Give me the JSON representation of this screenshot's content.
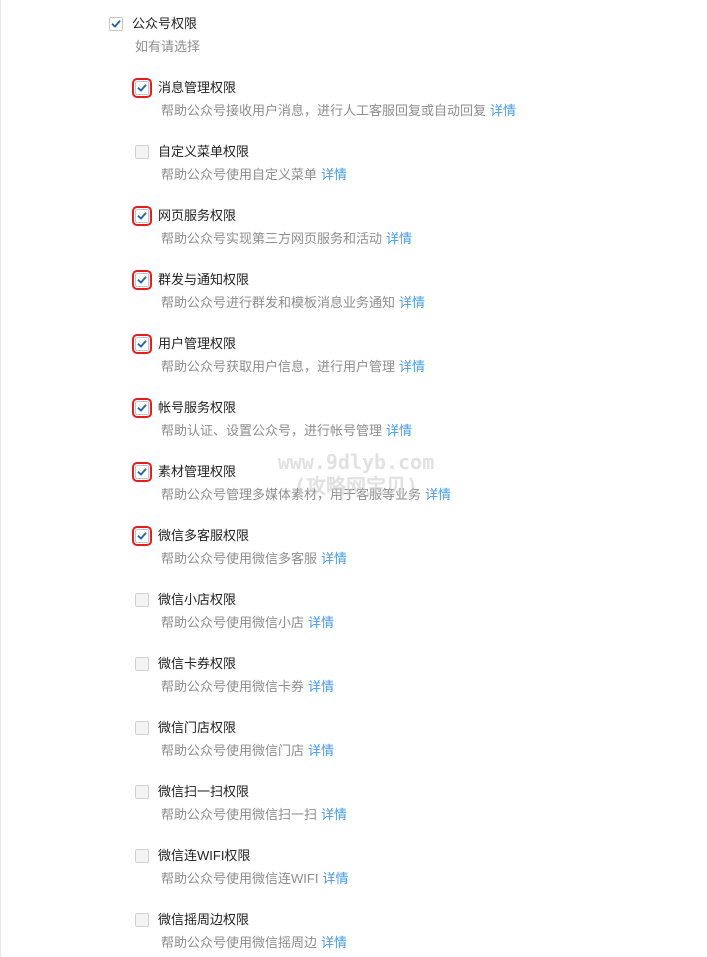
{
  "master": {
    "label": "公众号权限",
    "hint": "如有请选择",
    "checked": true
  },
  "detail_label": "详情",
  "permissions": [
    {
      "label": "消息管理权限",
      "desc": "帮助公众号接收用户消息，进行人工客服回复或自动回复",
      "checked": true,
      "highlighted": true
    },
    {
      "label": "自定义菜单权限",
      "desc": "帮助公众号使用自定义菜单",
      "checked": false,
      "highlighted": false
    },
    {
      "label": "网页服务权限",
      "desc": "帮助公众号实现第三方网页服务和活动",
      "checked": true,
      "highlighted": true
    },
    {
      "label": "群发与通知权限",
      "desc": "帮助公众号进行群发和模板消息业务通知",
      "checked": true,
      "highlighted": true
    },
    {
      "label": "用户管理权限",
      "desc": "帮助公众号获取用户信息，进行用户管理",
      "checked": true,
      "highlighted": true
    },
    {
      "label": "帐号服务权限",
      "desc": "帮助认证、设置公众号，进行帐号管理",
      "checked": true,
      "highlighted": true
    },
    {
      "label": "素材管理权限",
      "desc": "帮助公众号管理多媒体素材，用于客服等业务",
      "checked": true,
      "highlighted": true
    },
    {
      "label": "微信多客服权限",
      "desc": "帮助公众号使用微信多客服",
      "checked": true,
      "highlighted": true
    },
    {
      "label": "微信小店权限",
      "desc": "帮助公众号使用微信小店",
      "checked": false,
      "highlighted": false
    },
    {
      "label": "微信卡券权限",
      "desc": "帮助公众号使用微信卡券",
      "checked": false,
      "highlighted": false
    },
    {
      "label": "微信门店权限",
      "desc": "帮助公众号使用微信门店",
      "checked": false,
      "highlighted": false
    },
    {
      "label": "微信扫一扫权限",
      "desc": "帮助公众号使用微信扫一扫",
      "checked": false,
      "highlighted": false
    },
    {
      "label": "微信连WIFI权限",
      "desc": "帮助公众号使用微信连WIFI",
      "checked": false,
      "highlighted": false
    },
    {
      "label": "微信摇周边权限",
      "desc": "帮助公众号使用微信摇周边",
      "checked": false,
      "highlighted": false
    }
  ],
  "watermark": {
    "line1": "www.9dlyb.com",
    "line2": "(攻略网宝贝)"
  },
  "colors": {
    "link": "#459ae9",
    "check": "#1a5fa8",
    "highlight": "#e02020"
  }
}
